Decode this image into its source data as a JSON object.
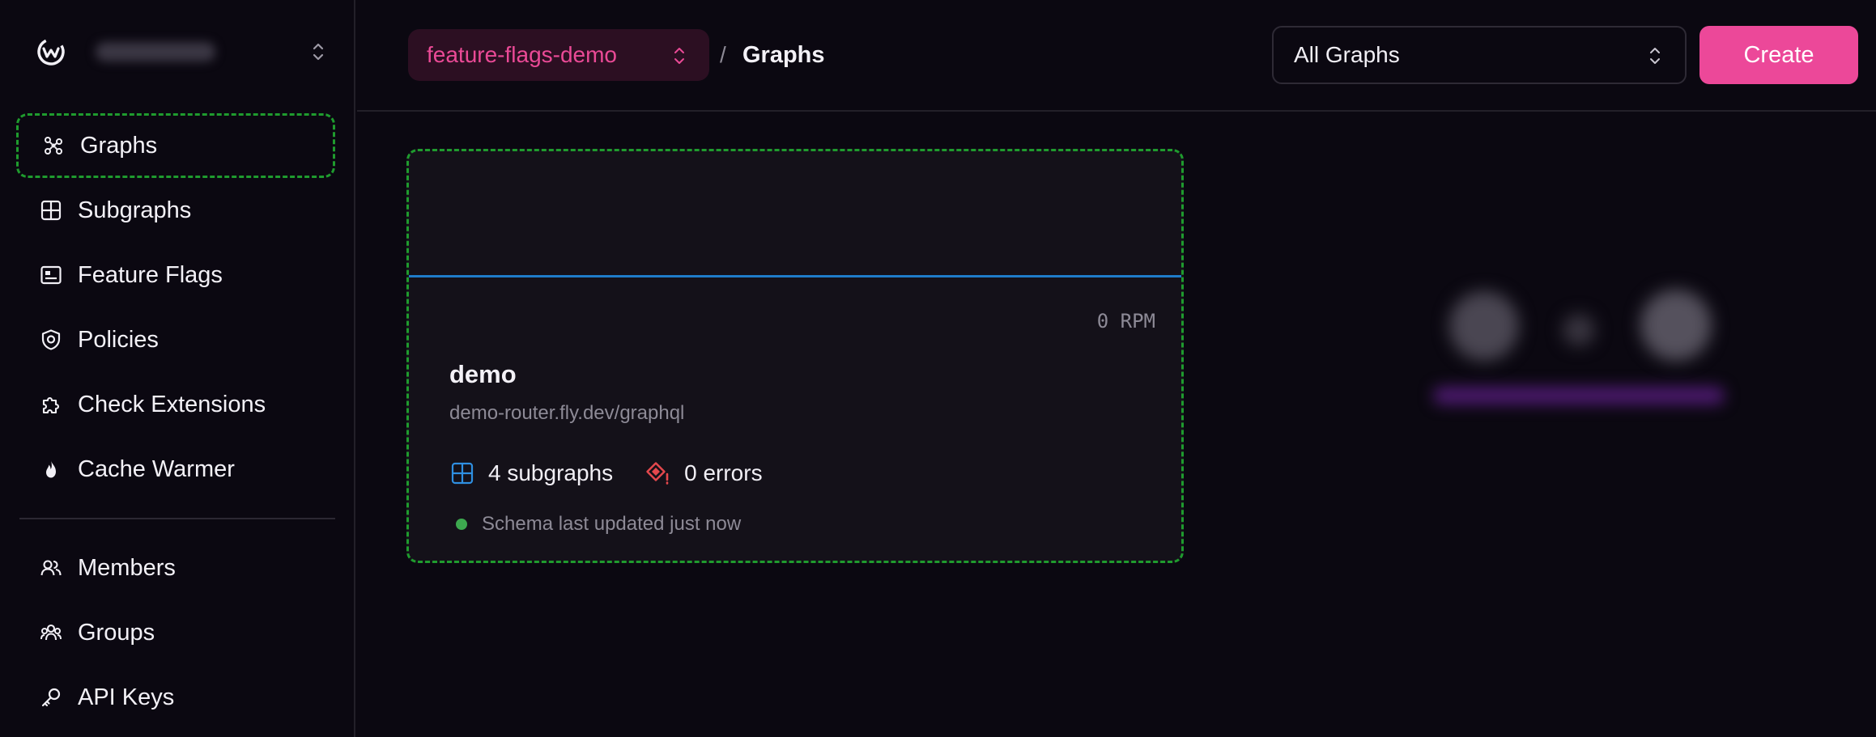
{
  "sidebar": {
    "nav_primary": [
      {
        "label": "Graphs",
        "icon": "graph-icon",
        "active": true
      },
      {
        "label": "Subgraphs",
        "icon": "grid-icon",
        "active": false
      },
      {
        "label": "Feature Flags",
        "icon": "flag-card-icon",
        "active": false
      },
      {
        "label": "Policies",
        "icon": "shield-icon",
        "active": false
      },
      {
        "label": "Check Extensions",
        "icon": "puzzle-icon",
        "active": false
      },
      {
        "label": "Cache Warmer",
        "icon": "flame-icon",
        "active": false
      }
    ],
    "nav_secondary": [
      {
        "label": "Members",
        "icon": "users-icon"
      },
      {
        "label": "Groups",
        "icon": "group-icon"
      },
      {
        "label": "API Keys",
        "icon": "key-icon"
      }
    ]
  },
  "header": {
    "namespace": "feature-flags-demo",
    "separator": "/",
    "current_page": "Graphs",
    "filter": {
      "selected": "All Graphs"
    },
    "create_label": "Create"
  },
  "graph_card": {
    "rpm": "0 RPM",
    "name": "demo",
    "url": "demo-router.fly.dev/graphql",
    "subgraphs": "4 subgraphs",
    "errors": "0 errors",
    "status": "Schema last updated just now"
  },
  "colors": {
    "background": "#0b0811",
    "accent": "#ec4899",
    "card": "#141119",
    "chart_line": "#1f7cc9",
    "status_ok": "#3da84f",
    "error": "#e5484d"
  }
}
